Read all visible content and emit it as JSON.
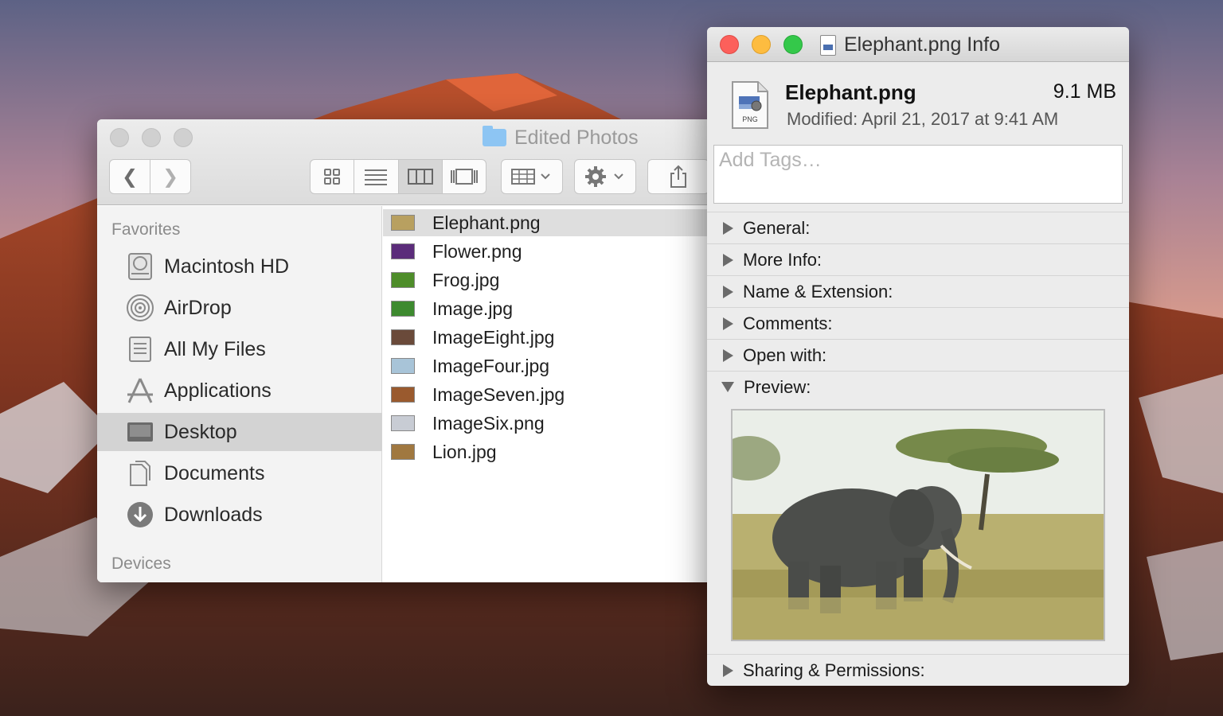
{
  "finder": {
    "title": "Edited Photos",
    "toolbar": {
      "back": "❮",
      "forward": "❯",
      "view_icon": "icon-view-icon",
      "view_list": "list-view-icon",
      "view_column": "column-view-icon",
      "view_gallery": "gallery-view-icon",
      "group": "group-icon",
      "action": "gear-icon",
      "share": "share-icon"
    },
    "sidebar": {
      "favorites_header": "Favorites",
      "items": [
        {
          "label": "Macintosh HD",
          "icon": "hard-drive-icon"
        },
        {
          "label": "AirDrop",
          "icon": "airdrop-icon"
        },
        {
          "label": "All My Files",
          "icon": "all-files-icon"
        },
        {
          "label": "Applications",
          "icon": "applications-icon"
        },
        {
          "label": "Desktop",
          "icon": "desktop-icon"
        },
        {
          "label": "Documents",
          "icon": "documents-icon"
        },
        {
          "label": "Downloads",
          "icon": "downloads-icon"
        }
      ],
      "devices_header": "Devices"
    },
    "files": [
      {
        "name": "Elephant.png",
        "color": "#b8a060"
      },
      {
        "name": "Flower.png",
        "color": "#5b2c7a"
      },
      {
        "name": "Frog.jpg",
        "color": "#4e8d2a"
      },
      {
        "name": "Image.jpg",
        "color": "#3d8a2f"
      },
      {
        "name": "ImageEight.jpg",
        "color": "#6a4a3a"
      },
      {
        "name": "ImageFour.jpg",
        "color": "#a8c4d8"
      },
      {
        "name": "ImageSeven.jpg",
        "color": "#9a5a2e"
      },
      {
        "name": "ImageSix.png",
        "color": "#c8ccd4"
      },
      {
        "name": "Lion.jpg",
        "color": "#a07840"
      }
    ]
  },
  "info": {
    "title": "Elephant.png Info",
    "name": "Elephant.png",
    "size": "9.1 MB",
    "modified": "Modified: April 21, 2017 at 9:41 AM",
    "icon_label": "PNG",
    "tags_placeholder": "Add Tags…",
    "sections": {
      "general": "General:",
      "more_info": "More Info:",
      "name_ext": "Name & Extension:",
      "comments": "Comments:",
      "open_with": "Open with:",
      "preview": "Preview:",
      "sharing": "Sharing & Permissions:"
    }
  }
}
